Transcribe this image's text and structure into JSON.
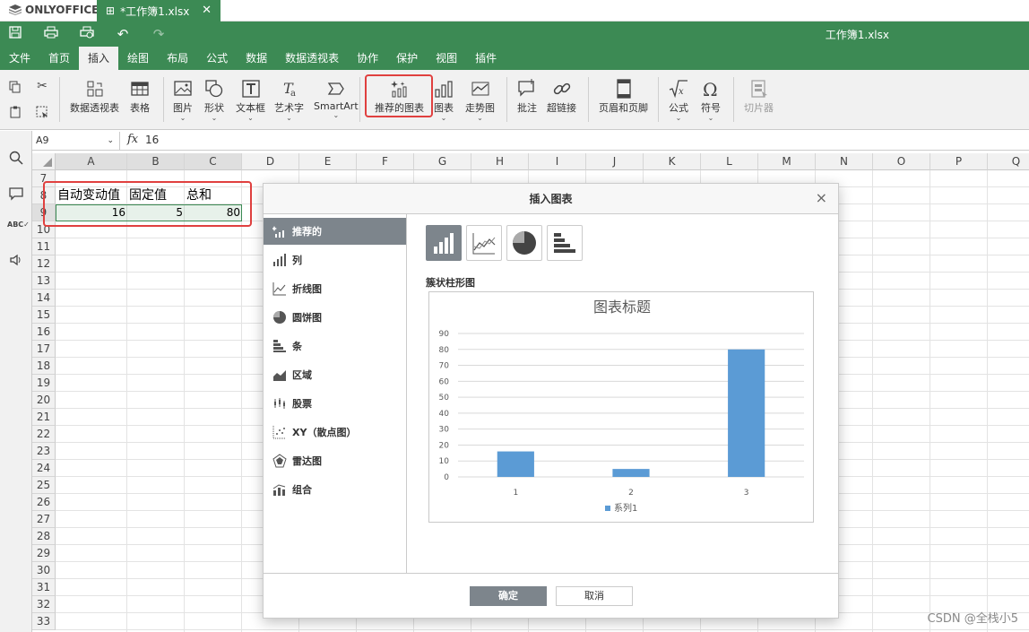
{
  "app": {
    "logo": "ONLYOFFICE",
    "doc_tab": "*工作簿1.xlsx",
    "file_title": "工作簿1.xlsx"
  },
  "menu_tabs": [
    "文件",
    "首页",
    "插入",
    "绘图",
    "布局",
    "公式",
    "数据",
    "数据透视表",
    "协作",
    "保护",
    "视图",
    "插件"
  ],
  "active_menu_tab": "插入",
  "ribbon": {
    "pivot": "数据透视表",
    "table": "表格",
    "image": "图片",
    "shape": "形状",
    "textbox": "文本框",
    "textart": "艺术字",
    "smartart": "SmartArt",
    "recommended_chart": "推荐的图表",
    "chart": "图表",
    "sparkline": "走势图",
    "comment": "批注",
    "hyperlink": "超链接",
    "header_footer": "页眉和页脚",
    "equation": "公式",
    "symbol": "符号",
    "slicer": "切片器"
  },
  "formula_bar": {
    "name_box": "A9",
    "fx": "fx",
    "value": "16"
  },
  "grid": {
    "columns": [
      "A",
      "B",
      "C",
      "D",
      "E",
      "F",
      "G",
      "H",
      "I",
      "J",
      "K",
      "L",
      "M",
      "N",
      "O",
      "P",
      "Q"
    ],
    "rows": [
      "7",
      "8",
      "9",
      "10",
      "11",
      "12",
      "13",
      "14",
      "15",
      "16",
      "17",
      "18",
      "19",
      "20",
      "21",
      "22",
      "23",
      "24",
      "25",
      "26",
      "27",
      "28",
      "29",
      "30",
      "31",
      "32",
      "33"
    ],
    "cells": {
      "A8": "自动变动值",
      "B8": "固定值",
      "C8": "总和",
      "A9": "16",
      "B9": "5",
      "C9": "80"
    }
  },
  "dialog": {
    "title": "插入图表",
    "close": "×",
    "categories": [
      "推荐的",
      "列",
      "折线图",
      "圆饼图",
      "条",
      "区域",
      "股票",
      "XY（散点图）",
      "雷达图",
      "组合"
    ],
    "active_category": "推荐的",
    "subtype_label": "簇状柱形图",
    "ok": "确定",
    "cancel": "取消"
  },
  "chart_data": {
    "type": "bar",
    "title": "图表标题",
    "categories": [
      "1",
      "2",
      "3"
    ],
    "series": [
      {
        "name": "系列1",
        "values": [
          16,
          5,
          80
        ]
      }
    ],
    "ylim": [
      0,
      90
    ],
    "yticks": [
      0,
      10,
      20,
      30,
      40,
      50,
      60,
      70,
      80,
      90
    ],
    "grid": true,
    "legend": "bottom",
    "color": "#5b9bd5"
  },
  "watermark": "CSDN @全栈小5",
  "colors": {
    "brand_green": "#3c8a54",
    "highlight_red": "#e0403f",
    "dialog_active": "#7d858c"
  }
}
